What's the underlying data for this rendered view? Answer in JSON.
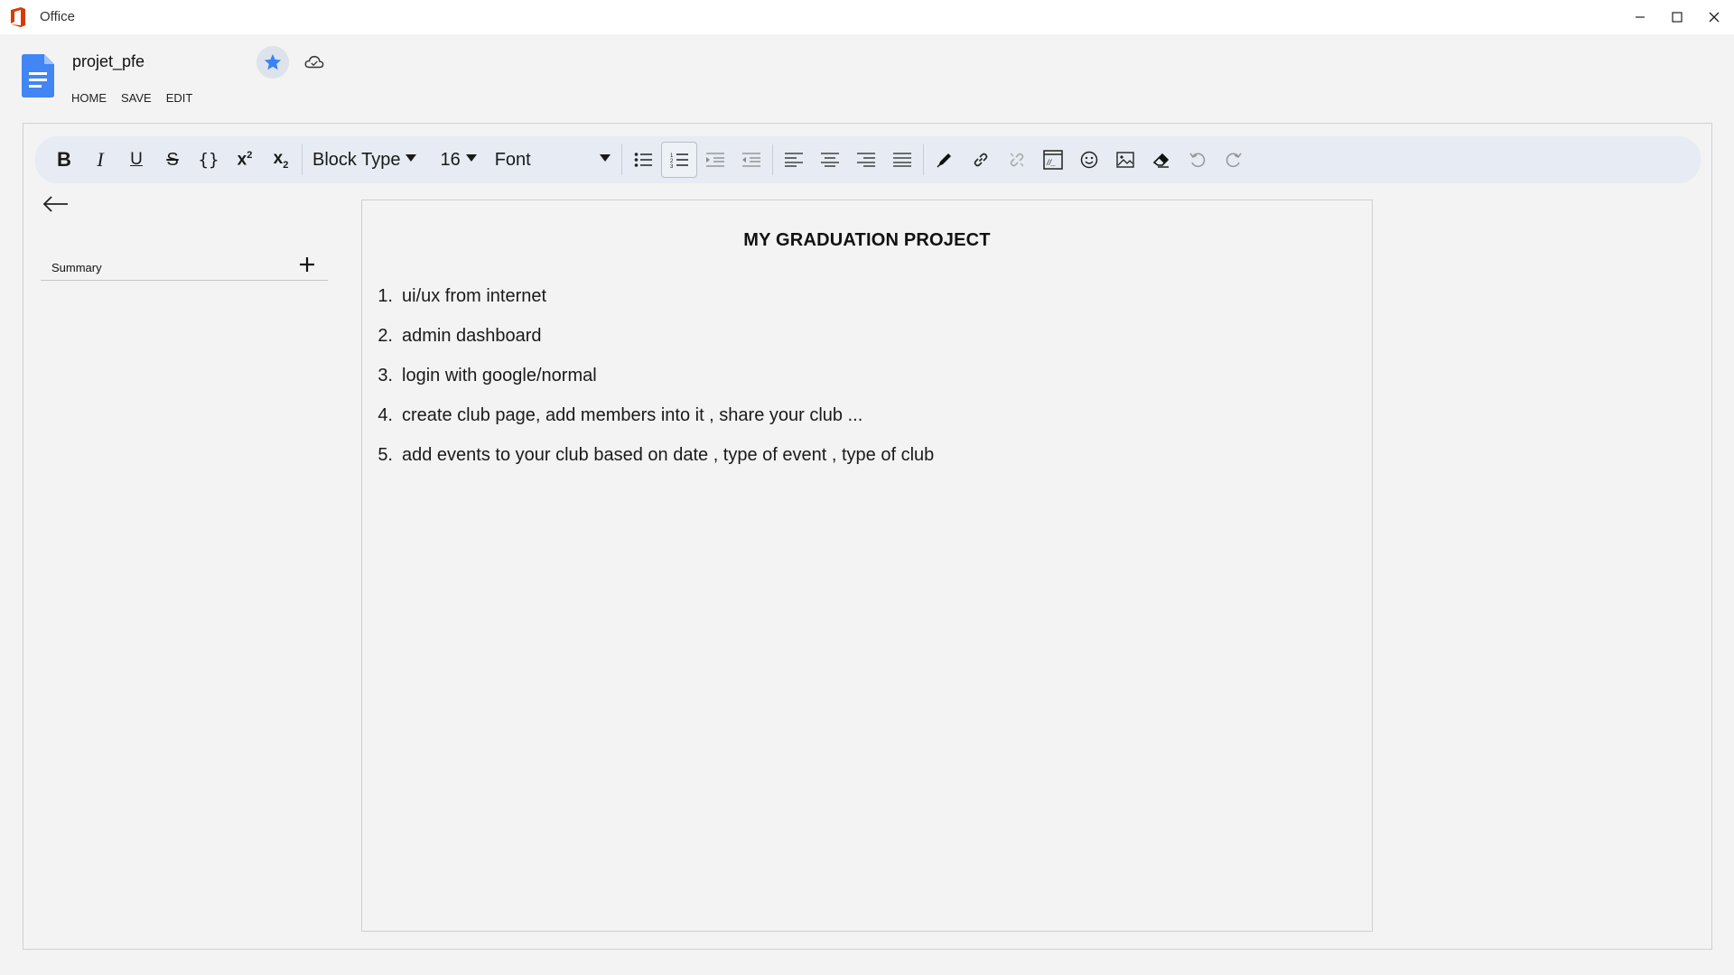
{
  "window": {
    "app_name": "Office"
  },
  "document": {
    "name": "projet_pfe",
    "menu": [
      "HOME",
      "SAVE",
      "EDIT"
    ]
  },
  "toolbar": {
    "block_type": "Block Type",
    "font_size": "16",
    "font": "Font",
    "buttons": [
      "bold",
      "italic",
      "underline",
      "strikethrough",
      "code",
      "superscript",
      "subscript",
      "bullet-list",
      "numbered-list",
      "indent",
      "outdent",
      "align-left",
      "align-center",
      "align-right",
      "align-justify",
      "pen",
      "link",
      "unlink",
      "embed",
      "emoji",
      "image",
      "eraser",
      "undo",
      "redo"
    ],
    "active": "numbered-list"
  },
  "sidebar": {
    "summary_label": "Summary"
  },
  "content": {
    "title": "MY GRADUATION PROJECT",
    "items": [
      {
        "num": "1.",
        "text": "ui/ux from internet"
      },
      {
        "num": "2.",
        "text": "admin dashboard"
      },
      {
        "num": "3.",
        "text": "login with google/normal"
      },
      {
        "num": "4.",
        "text": "create club page, add members into it , share your club ..."
      },
      {
        "num": "5.",
        "text": "add events to your club based on date , type of event , type of club"
      }
    ]
  },
  "colors": {
    "accent": "#3b82f6",
    "doc_icon": "#4285f4",
    "toolbar_bg": "#e7ebf3",
    "office_red": "#d83b01"
  }
}
